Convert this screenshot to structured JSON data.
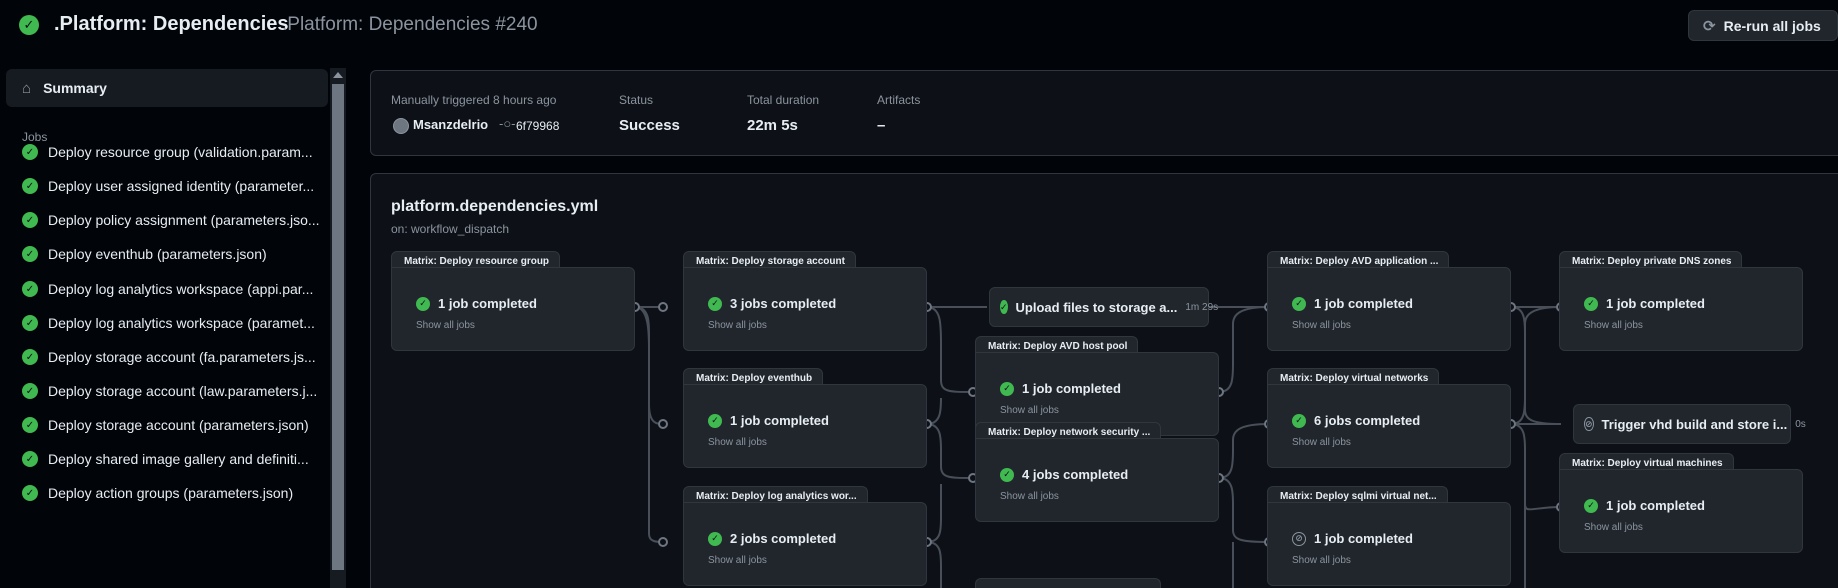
{
  "header": {
    "workflow_name": ".Platform: Dependencies",
    "run_name": ".Platform: Dependencies #240",
    "rerun_label": "Re-run all jobs",
    "status_icon": "check-circle-fill-icon"
  },
  "sidebar": {
    "summary_label": "Summary",
    "jobs_heading": "Jobs",
    "jobs": [
      "Deploy resource group (validation.param...",
      "Deploy user assigned identity (parameter...",
      "Deploy policy assignment (parameters.jso...",
      "Deploy eventhub (parameters.json)",
      "Deploy log analytics workspace (appi.par...",
      "Deploy log analytics workspace (paramet...",
      "Deploy storage account (fa.parameters.js...",
      "Deploy storage account (law.parameters.j...",
      "Deploy storage account (parameters.json)",
      "Deploy shared image gallery and definiti...",
      "Deploy action groups (parameters.json)"
    ]
  },
  "summary": {
    "trigger_label": "Manually triggered 8 hours ago",
    "actor": "Msanzdelrio",
    "commit": "6f79968",
    "status_label": "Status",
    "status_value": "Success",
    "duration_label": "Total duration",
    "duration_value": "22m 5s",
    "artifacts_label": "Artifacts",
    "artifacts_value": "–"
  },
  "graph": {
    "file": "platform.dependencies.yml",
    "trigger": "on: workflow_dispatch",
    "show_all": "Show all jobs",
    "jobs": {
      "rg": {
        "title": "Matrix: Deploy resource group",
        "status": "1 job completed"
      },
      "sa": {
        "title": "Matrix: Deploy storage account",
        "status": "3 jobs completed"
      },
      "eh": {
        "title": "Matrix: Deploy eventhub",
        "status": "1 job completed"
      },
      "law": {
        "title": "Matrix: Deploy log analytics wor...",
        "status": "2 jobs completed"
      },
      "upload": {
        "title": "Upload files to storage a...",
        "duration": "1m 29s"
      },
      "hp": {
        "title": "Matrix: Deploy AVD host pool",
        "status": "1 job completed"
      },
      "nsg": {
        "title": "Matrix: Deploy network security ...",
        "status": "4 jobs completed"
      },
      "app": {
        "title": "Matrix: Deploy AVD application ...",
        "status": "1 job completed"
      },
      "vnet": {
        "title": "Matrix: Deploy virtual networks",
        "status": "6 jobs completed"
      },
      "sqlmi": {
        "title": "Matrix: Deploy sqlmi virtual net...",
        "status": "1 job completed"
      },
      "dns": {
        "title": "Matrix: Deploy private DNS zones",
        "status": "1 job completed"
      },
      "vhd": {
        "title": "Trigger vhd build and store i...",
        "duration": "0s"
      },
      "vm": {
        "title": "Matrix: Deploy virtual machines",
        "status": "1 job completed"
      }
    }
  }
}
